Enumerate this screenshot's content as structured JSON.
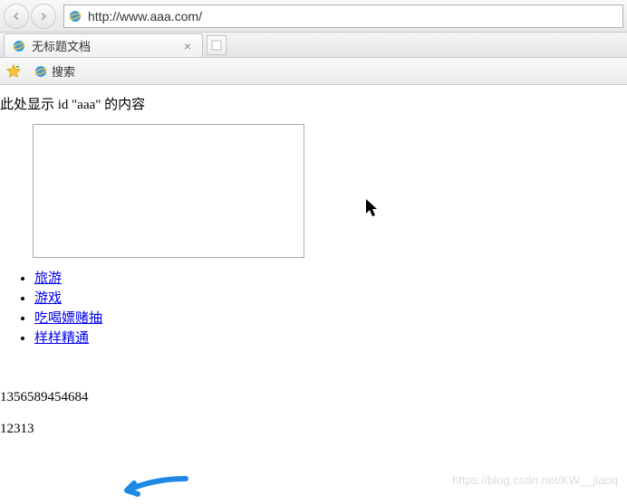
{
  "nav": {
    "url": "http://www.aaa.com/"
  },
  "tab": {
    "title": "无标题文档"
  },
  "favorites": {
    "search_label": "搜索"
  },
  "page": {
    "line1": "此处显示 id \"aaa\" 的内容",
    "links": [
      "旅游",
      "游戏",
      "吃喝嫖赌抽",
      "样样精通"
    ],
    "num1": "1356589454684",
    "num2": "12313"
  },
  "watermark": "https://blog.csdn.net/KW__jiaoq"
}
